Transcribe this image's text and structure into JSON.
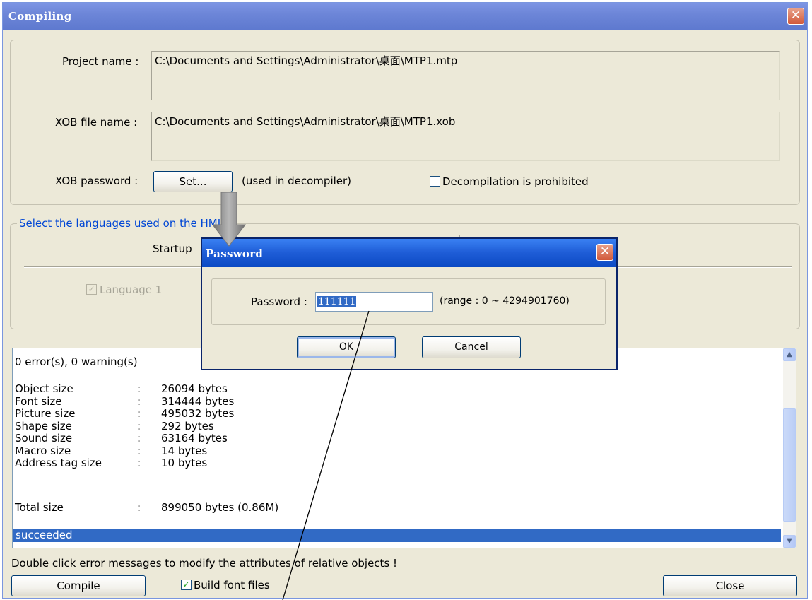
{
  "main_window": {
    "title": "Compiling",
    "project_name_label": "Project name :",
    "project_name_value": "C:\\Documents and Settings\\Administrator\\桌面\\MTP1.mtp",
    "xob_file_label": "XOB file name :",
    "xob_file_value": "C:\\Documents and Settings\\Administrator\\桌面\\MTP1.xob",
    "xob_password_label": "XOB password :",
    "set_button": "Set...",
    "set_hint": "(used in decompiler)",
    "decompile_checkbox": "Decompilation is prohibited",
    "languages_group_label": "Select the languages used on the HMI",
    "startup_label": "Startup",
    "language1_label": "Language 1",
    "output": {
      "summary": "0 error(s), 0 warning(s)",
      "stats": [
        {
          "name": "Object size",
          "colon": ":",
          "value": "26094 bytes"
        },
        {
          "name": "Font size",
          "colon": ":",
          "value": "314444 bytes"
        },
        {
          "name": "Picture size",
          "colon": ":",
          "value": "495032 bytes"
        },
        {
          "name": "Shape size",
          "colon": ":",
          "value": "292 bytes"
        },
        {
          "name": "Sound size",
          "colon": ":",
          "value": "63164 bytes"
        },
        {
          "name": "Macro size",
          "colon": ":",
          "value": "14 bytes"
        },
        {
          "name": "Address tag size",
          "colon": ":",
          "value": "10 bytes"
        }
      ],
      "total_label": "Total size",
      "total_colon": ":",
      "total_value": "899050 bytes (0.86M)",
      "status": "succeeded"
    },
    "hint": "Double click error messages to modify the attributes of relative objects !",
    "compile_button": "Compile",
    "build_font_checkbox": "Build font files",
    "close_button": "Close"
  },
  "password_dialog": {
    "title": "Password",
    "password_label": "Password :",
    "password_value": "111111",
    "range_text": "(range : 0 ~ 4294901760)",
    "ok_button": "OK",
    "cancel_button": "Cancel"
  },
  "colors": {
    "main_title_bar": "#6d86d8",
    "dialog_title_bar": "#1e5cd6",
    "close_button": "#d2593a",
    "selection": "#316ac5",
    "window_bg": "#ece9d8"
  },
  "icons": [
    "close-icon",
    "checkmark-icon",
    "scroll-up-icon",
    "scroll-down-icon",
    "down-arrow-icon"
  ]
}
